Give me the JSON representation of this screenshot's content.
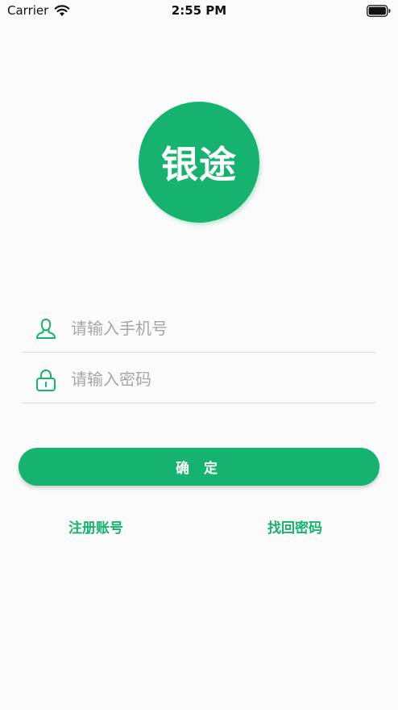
{
  "status_bar": {
    "carrier": "Carrier",
    "time": "2:55 PM"
  },
  "logo": {
    "text": "银途"
  },
  "form": {
    "phone_placeholder": "请输入手机号",
    "password_placeholder": "请输入密码"
  },
  "confirm_button": {
    "label": "确 定"
  },
  "links": {
    "register": "注册账号",
    "forgot_password": "找回密码"
  },
  "colors": {
    "brand": "#16b26f",
    "placeholder": "#a6a6a6",
    "divider": "#d6d6d6",
    "background": "#fbfbfb"
  },
  "icons": {
    "wifi": "wifi-icon",
    "battery": "battery-icon",
    "user": "user-icon",
    "lock": "lock-icon"
  }
}
